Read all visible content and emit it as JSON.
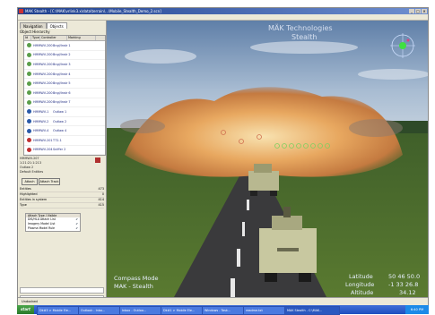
{
  "window": {
    "title": "MAK Stealth - [C:\\MAK\\vrlink3.x\\data\\terrain\\...\\Mobile_Stealth_Demo_2.scn]",
    "buttons": [
      "_",
      "□",
      "✕"
    ]
  },
  "menu": [
    "File",
    "View",
    "Scenario",
    "View Mode",
    "Models",
    "Options",
    "Help"
  ],
  "left_panel": {
    "tabs": [
      "Navigation",
      "Objects"
    ],
    "active_tab": "Objects",
    "section_title": "Object Hierarchy",
    "columns": [
      "Id",
      "Type",
      "Controller",
      "Marking"
    ],
    "rows": [
      {
        "controller": "HMMWV-200",
        "marking": "Bngl/Instr 1",
        "color": "#5b9e4a"
      },
      {
        "controller": "HMMWV-200",
        "marking": "Bngl/Instr 2",
        "color": "#5b9e4a"
      },
      {
        "controller": "HMMWV-200",
        "marking": "Bngl/Instr 3",
        "color": "#5b9e4a"
      },
      {
        "controller": "HMMWV-200",
        "marking": "Bngl/Instr 4",
        "color": "#5b9e4a"
      },
      {
        "controller": "HMMWV-200",
        "marking": "Bngl/Instr 5",
        "color": "#5b9e4a"
      },
      {
        "controller": "HMMWV-200",
        "marking": "Bngl/Instr 6",
        "color": "#5b9e4a"
      },
      {
        "controller": "HMMWV-200",
        "marking": "Bngl/Instr 7",
        "color": "#5b9e4a"
      },
      {
        "controller": "HMMWV-1",
        "marking": "Outlaw 1",
        "color": "#2a5aa8"
      },
      {
        "controller": "HMMWV-2",
        "marking": "Outlaw 2",
        "color": "#2a5aa8"
      },
      {
        "controller": "HMMWV-4",
        "marking": "Outlaw 4",
        "color": "#2a5aa8"
      },
      {
        "controller": "HMMWV-201",
        "marking": "T72-1",
        "color": "#c03030"
      },
      {
        "controller": "HMMWV-204",
        "marking": "Sniffer 2",
        "color": "#c03030"
      },
      {
        "controller": "HMMWV-206",
        "marking": "Sniffer 3",
        "color": "#c03030"
      },
      {
        "controller": "HMMWV-201",
        "marking": "Sniffer 4",
        "color": "#c03030"
      },
      {
        "controller": "HMMWV-204",
        "marking": "mod ctr 5",
        "color": "#c03030"
      }
    ],
    "info": [
      "HMMWV-207",
      "1:21:21:1:213",
      "Outlaw 2",
      "Default Entities"
    ],
    "attach_button": "Attach",
    "attach_track_button": "Attach Track",
    "entity_section": {
      "title": "Entities",
      "count": "473",
      "rows": [
        {
          "label": "Highlighted",
          "value": "0"
        },
        {
          "label": "Entities in system",
          "value": "414"
        },
        {
          "label": "Type",
          "value": "415"
        }
      ]
    },
    "options_table": {
      "header": "Attach Type / Visible",
      "rows": [
        {
          "label": "DIS/HLA Attach List",
          "value": "✔"
        },
        {
          "label": "Imagery Model List",
          "value": "✔"
        },
        {
          "label": "Plasma Model Rule",
          "value": "✔"
        }
      ]
    }
  },
  "viewport": {
    "mode_label": "Compass Mode",
    "app_label": "MAK - Stealth",
    "watermark_line1": "MÄK Technologies",
    "watermark_line2": "Stealth",
    "latitude_label": "Latitude",
    "latitude_value": "50 46 50.0",
    "longitude_label": "Longitude",
    "longitude_value": "-1 33 26.8",
    "altitude_label": "Altitude",
    "altitude_value": "34.12"
  },
  "status_bar": {
    "text": "Undocked"
  },
  "taskbar": {
    "start": "start",
    "items": [
      "Dk#3 > Mobile Ele...",
      "Outlook - Inbo...",
      "Inbox - Outloo...",
      "Dk#1 > Mobile Ele...",
      "Windows - Task...",
      "readme.txt",
      "MAK Stealth - C:\\MAK..."
    ],
    "clock": "6:40 PM"
  }
}
